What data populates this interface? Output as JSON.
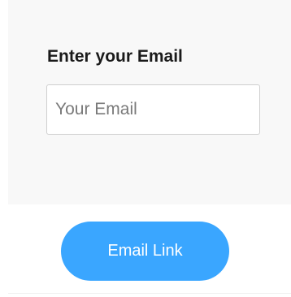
{
  "email_form": {
    "label": "Enter your Email",
    "input_value": "",
    "input_placeholder": "Your Email",
    "submit_label": "Email Link"
  }
}
